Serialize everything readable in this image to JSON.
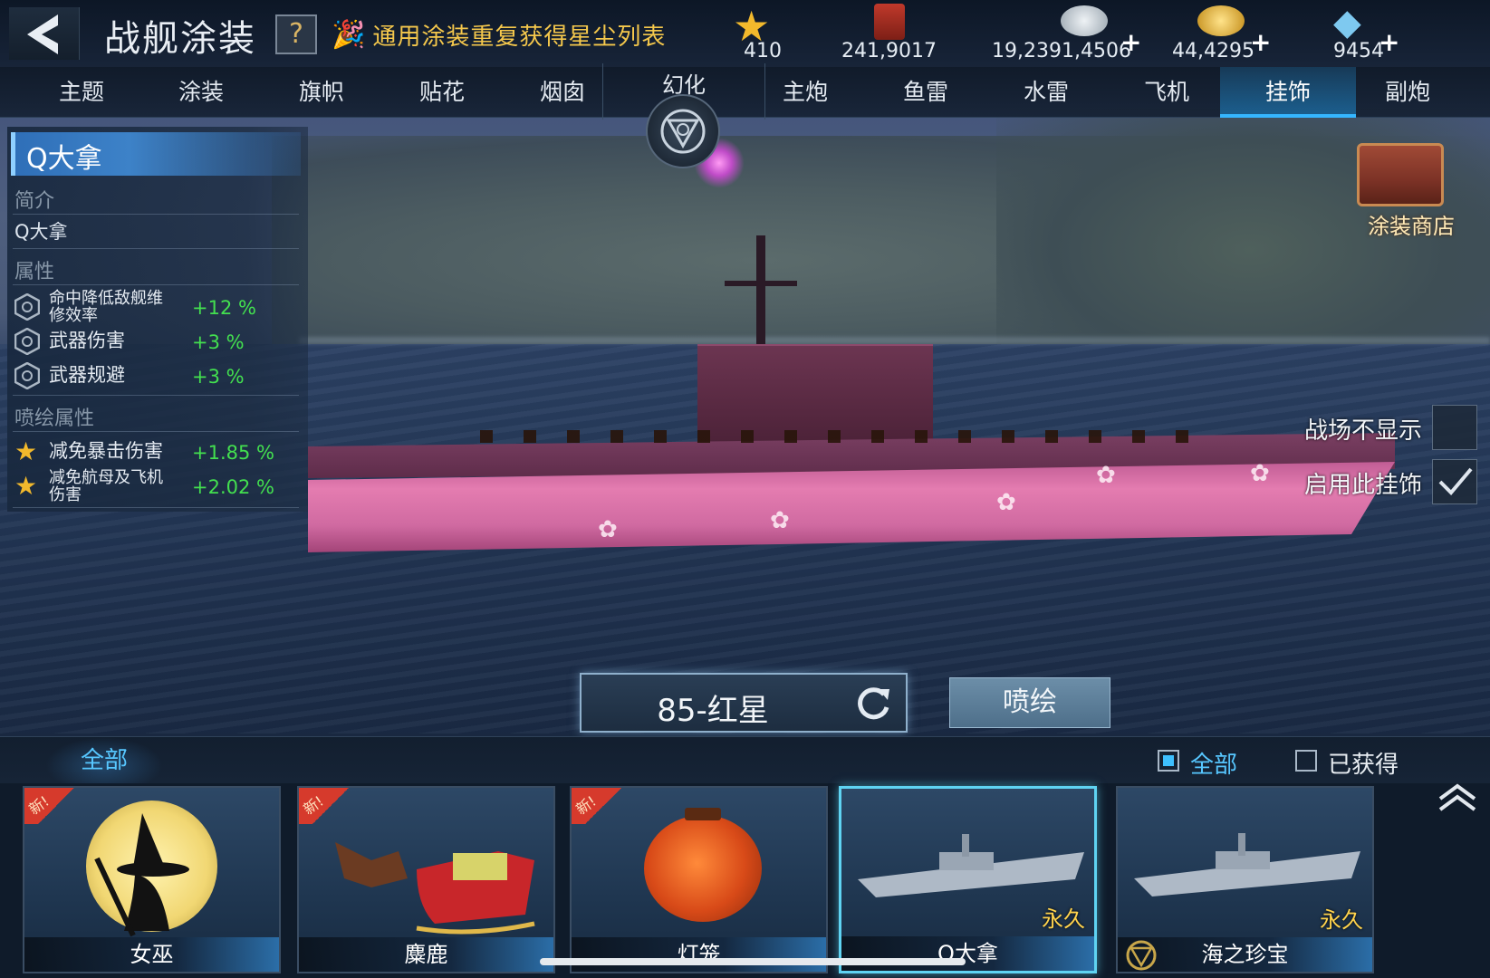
{
  "header": {
    "title": "战舰涂装",
    "help_label": "?",
    "stardust_link": "通用涂装重复获得星尘列表",
    "currencies": [
      {
        "icon": "star-icon",
        "value": "410",
        "plus": ""
      },
      {
        "icon": "paint-bucket-icon",
        "value": "241,9017",
        "plus": ""
      },
      {
        "icon": "silver-coin-icon",
        "value": "19,2391,4506",
        "plus": "+"
      },
      {
        "icon": "gold-coin-icon",
        "value": "44,4295",
        "plus": "+"
      },
      {
        "icon": "diamond-icon",
        "value": "9454",
        "plus": "+"
      }
    ]
  },
  "tabs": [
    {
      "label": "主题",
      "active": false
    },
    {
      "label": "涂装",
      "active": false
    },
    {
      "label": "旗帜",
      "active": false
    },
    {
      "label": "贴花",
      "active": false
    },
    {
      "label": "烟囱",
      "active": false
    },
    {
      "label": "主炮",
      "active": false
    },
    {
      "label": "鱼雷",
      "active": false
    },
    {
      "label": "水雷",
      "active": false
    },
    {
      "label": "飞机",
      "active": false
    },
    {
      "label": "挂饰",
      "active": true
    },
    {
      "label": "副炮",
      "active": false
    }
  ],
  "transform_tab": {
    "label": "幻化"
  },
  "info": {
    "name": "Q大拿",
    "intro_heading": "简介",
    "intro_text": "Q大拿",
    "attr_heading": "属性",
    "attributes": [
      {
        "name": "命中降低敌舰维修效率",
        "line1": "命中降低敌舰维",
        "line2": "修效率",
        "value": "+12 %"
      },
      {
        "name": "武器伤害",
        "value": "+3 %"
      },
      {
        "name": "武器规避",
        "value": "+3 %"
      }
    ],
    "spray_heading": "喷绘属性",
    "spray_attributes": [
      {
        "name": "减免暴击伤害",
        "value": "+1.85 %"
      },
      {
        "name": "减免航母及飞机伤害",
        "line1": "减免航母及飞机",
        "line2": "伤害",
        "value": "+2.02 %"
      }
    ]
  },
  "shop": {
    "label": "涂装商店"
  },
  "toggles": {
    "hide_in_battle": {
      "label": "战场不显示",
      "checked": false
    },
    "enable_pendant": {
      "label": "启用此挂饰",
      "checked": true
    }
  },
  "paint": {
    "name": "85-红星",
    "spray_label": "喷绘"
  },
  "filters": {
    "all_tab": "全部",
    "check_all": {
      "label": "全部",
      "checked": true
    },
    "check_owned": {
      "label": "已获得",
      "checked": false
    }
  },
  "items": [
    {
      "name": "女巫",
      "new": true,
      "new_label": "新!",
      "permanent": "",
      "art": "witch"
    },
    {
      "name": "麋鹿",
      "new": true,
      "new_label": "新!",
      "permanent": "",
      "art": "sleigh"
    },
    {
      "name": "灯笼",
      "new": true,
      "new_label": "新!",
      "permanent": "",
      "art": "lantern"
    },
    {
      "name": "Q大拿",
      "new": false,
      "new_label": "",
      "permanent": "永久",
      "art": "ship",
      "selected": true
    },
    {
      "name": "海之珍宝",
      "new": false,
      "new_label": "",
      "permanent": "永久",
      "art": "ship"
    }
  ],
  "colors": {
    "accent": "#35b6ff",
    "positive": "#43e04f",
    "gold": "#f5c84c",
    "hull_pink": "#e47cb0"
  }
}
